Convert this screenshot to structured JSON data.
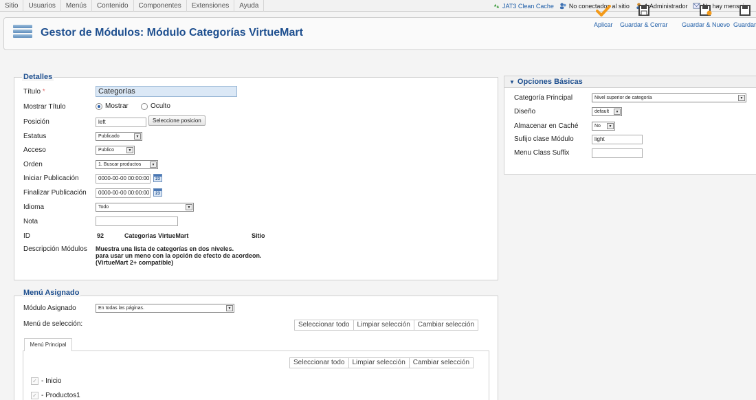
{
  "topmenu": {
    "items": [
      "Sitio",
      "Usuarios",
      "Menús",
      "Contenido",
      "Componentes",
      "Extensiones",
      "Ayuda"
    ]
  },
  "status": {
    "cache": "JAT3 Clean Cache",
    "connected": "No conectados al sitio",
    "admins": "1 Administrador",
    "messages": "No hay mensajes"
  },
  "header": {
    "title": "Gestor de Módulos: Módulo Categorías VirtueMart"
  },
  "toolbar": {
    "apply": "Aplicar",
    "save_close": "Guardar & Cerrar",
    "save_new": "Guardar & Nuevo",
    "save": "Guardar"
  },
  "details": {
    "legend": "Detalles",
    "title_label": "Título",
    "required_mark": "*",
    "title_value": "Categorías",
    "show_title_label": "Mostrar Título",
    "show_option": "Mostrar",
    "hide_option": "Oculto",
    "position_label": "Posición",
    "position_value": "left",
    "select_position": "Seleccione posicion",
    "status_label": "Estatus",
    "status_value": "Publicado",
    "access_label": "Acceso",
    "access_value": "Publico",
    "order_label": "Orden",
    "order_value": "1. Buscar productos",
    "start_label": "Iniciar Publicación",
    "start_value": "0000-00-00 00:00:00",
    "end_label": "Finalizar Publicación",
    "end_value": "0000-00-00 00:00:00",
    "calendar_day": "23",
    "language_label": "Idioma",
    "language_value": "Todo",
    "note_label": "Nota",
    "note_value": "",
    "id_label": "ID",
    "id_value": "92",
    "module_name": "Categorias VirtueMart",
    "client": "Sitio",
    "desc_label": "Descripción Módulos",
    "desc_line1": "Muestra una lista de categorías en dos niveles.",
    "desc_line2": "para usar un meno con la opción de efecto de acordeon.",
    "desc_line3": "(VirtueMart 2+ compatible)"
  },
  "basic": {
    "header": "Opciones Básicas",
    "category_label": "Categoría Principal",
    "category_value": "Nivel superior de categoría",
    "layout_label": "Diseño",
    "layout_value": "default",
    "cache_label": "Almacenar en Caché",
    "cache_value": "No",
    "suffix_label": "Sufijo clase Módulo",
    "suffix_value": "light",
    "menu_suffix_label": "Menu Class Suffix",
    "menu_suffix_value": ""
  },
  "menu_assign": {
    "legend": "Menú Asignado",
    "assigned_label": "Módulo Asignado",
    "assigned_value": "En todas las páginas.",
    "selection_label": "Menú de selección:",
    "select_all": "Seleccionar todo",
    "clear_selection": "Limpiar selección",
    "toggle_selection": "Cambiar selección",
    "tab": "Menú Principal",
    "items": [
      "- Inicio",
      "- Productos1"
    ]
  }
}
